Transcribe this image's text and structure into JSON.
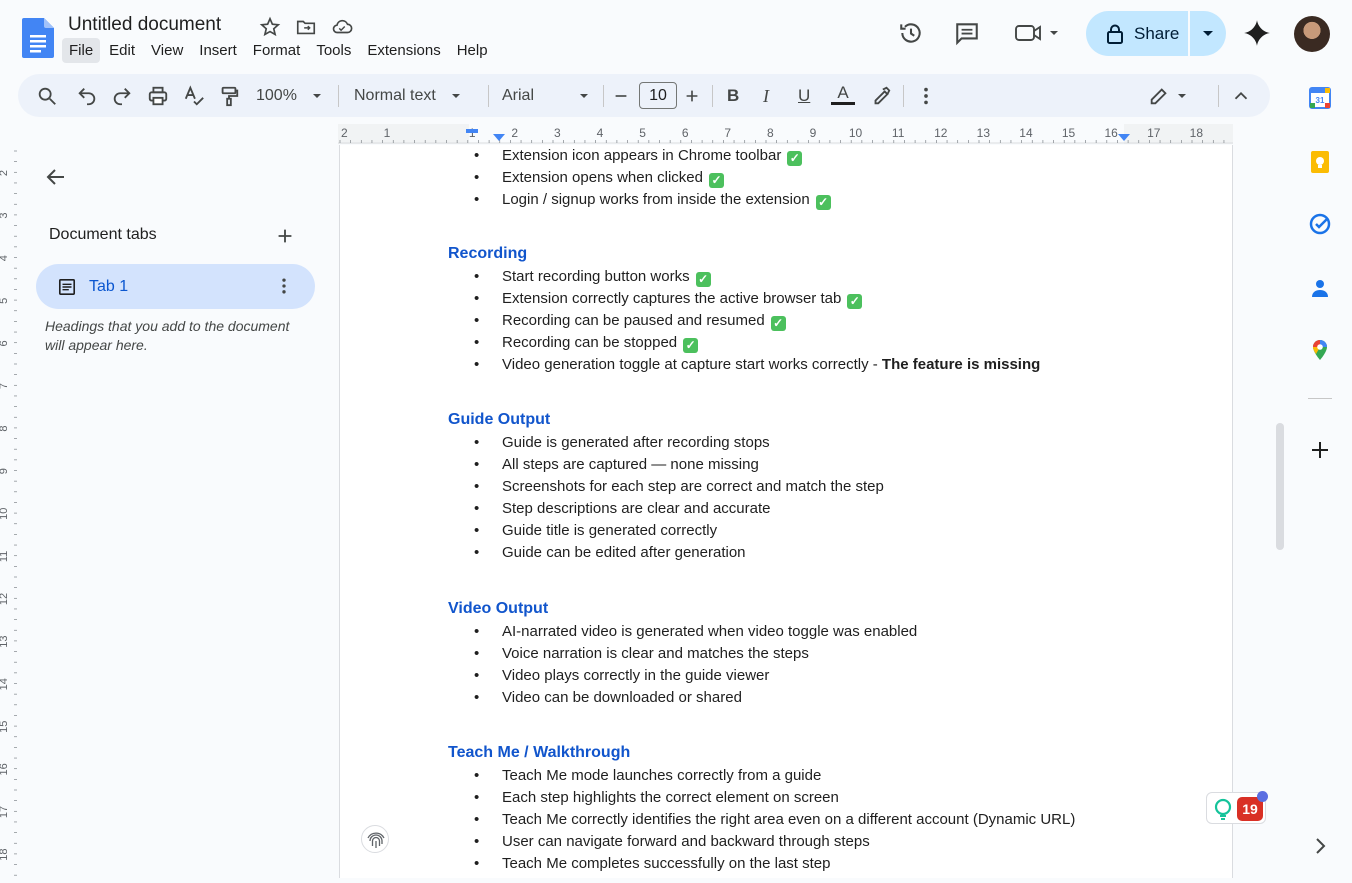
{
  "app": {
    "title": "Untitled document",
    "menu": [
      "File",
      "Edit",
      "View",
      "Insert",
      "Format",
      "Tools",
      "Extensions",
      "Help"
    ],
    "share_label": "Share"
  },
  "toolbar": {
    "zoom": "100%",
    "style": "Normal text",
    "font": "Arial",
    "font_size": "10",
    "bold": "B",
    "italic": "I",
    "underline": "U",
    "text_color": "A"
  },
  "ruler": {
    "ticks": [
      "2",
      "1",
      "1",
      "2",
      "3",
      "4",
      "5",
      "6",
      "7",
      "8",
      "9",
      "10",
      "11",
      "12",
      "13",
      "14",
      "15",
      "16",
      "17",
      "18"
    ],
    "left_ticks": [
      "2",
      "3",
      "4",
      "5",
      "6",
      "7",
      "8",
      "9",
      "10",
      "11",
      "12",
      "13",
      "14",
      "15",
      "16",
      "17",
      "18"
    ]
  },
  "sidepanel": {
    "heading": "Document tabs",
    "tab_label": "Tab 1",
    "note": "Headings that you add to the document will appear here."
  },
  "document": {
    "sections": [
      {
        "heading": "",
        "items": [
          {
            "text": "Extension icon appears in Chrome toolbar",
            "check": true
          },
          {
            "text": "Extension opens when clicked",
            "check": true
          },
          {
            "text": "Login / signup works from inside the extension",
            "check": true
          }
        ]
      },
      {
        "heading": "Recording",
        "items": [
          {
            "text": "Start recording button works",
            "check": true
          },
          {
            "text": "Extension correctly captures the active browser tab",
            "check": true
          },
          {
            "text": "Recording can be paused and resumed",
            "check": true
          },
          {
            "text": "Recording can be stopped",
            "check": true
          },
          {
            "text": "Video generation toggle at capture start works correctly - ",
            "bold_suffix": "The feature is missing",
            "check": false
          }
        ]
      },
      {
        "heading": "Guide Output",
        "items": [
          {
            "text": "Guide is generated after recording stops",
            "check": false
          },
          {
            "text": "All steps are captured — none missing",
            "check": false
          },
          {
            "text": "Screenshots for each step are correct and match the step",
            "check": false
          },
          {
            "text": "Step descriptions are clear and accurate",
            "check": false
          },
          {
            "text": "Guide title is generated correctly",
            "check": false
          },
          {
            "text": "Guide can be edited after generation",
            "check": false
          }
        ]
      },
      {
        "heading": "Video Output",
        "items": [
          {
            "text": "AI-narrated video is generated when video toggle was enabled",
            "check": false
          },
          {
            "text": "Voice narration is clear and matches the steps",
            "check": false
          },
          {
            "text": "Video plays correctly in the guide viewer",
            "check": false
          },
          {
            "text": "Video can be downloaded or shared",
            "check": false
          }
        ]
      },
      {
        "heading": "Teach Me / Walkthrough",
        "items": [
          {
            "text": "Teach Me mode launches correctly from a guide",
            "check": false
          },
          {
            "text": "Each step highlights the correct element on screen",
            "check": false
          },
          {
            "text": "Teach Me correctly identifies the right area even on a different account (Dynamic URL)",
            "check": false
          },
          {
            "text": "User can navigate forward and backward through steps",
            "check": false
          },
          {
            "text": "Teach Me completes successfully on the last step",
            "check": false
          }
        ]
      }
    ]
  },
  "badge": {
    "count": "19"
  },
  "colors": {
    "accent": "#0b57d0",
    "heading": "#1155cc",
    "share_bg": "#c2e7ff",
    "check": "#4cc05d"
  },
  "icons": {
    "top": [
      "history-icon",
      "comment-icon",
      "meet-icon",
      "gemini-icon"
    ],
    "rail": [
      "calendar-icon",
      "keep-icon",
      "tasks-icon",
      "contacts-icon",
      "maps-icon",
      "add-icon"
    ]
  }
}
